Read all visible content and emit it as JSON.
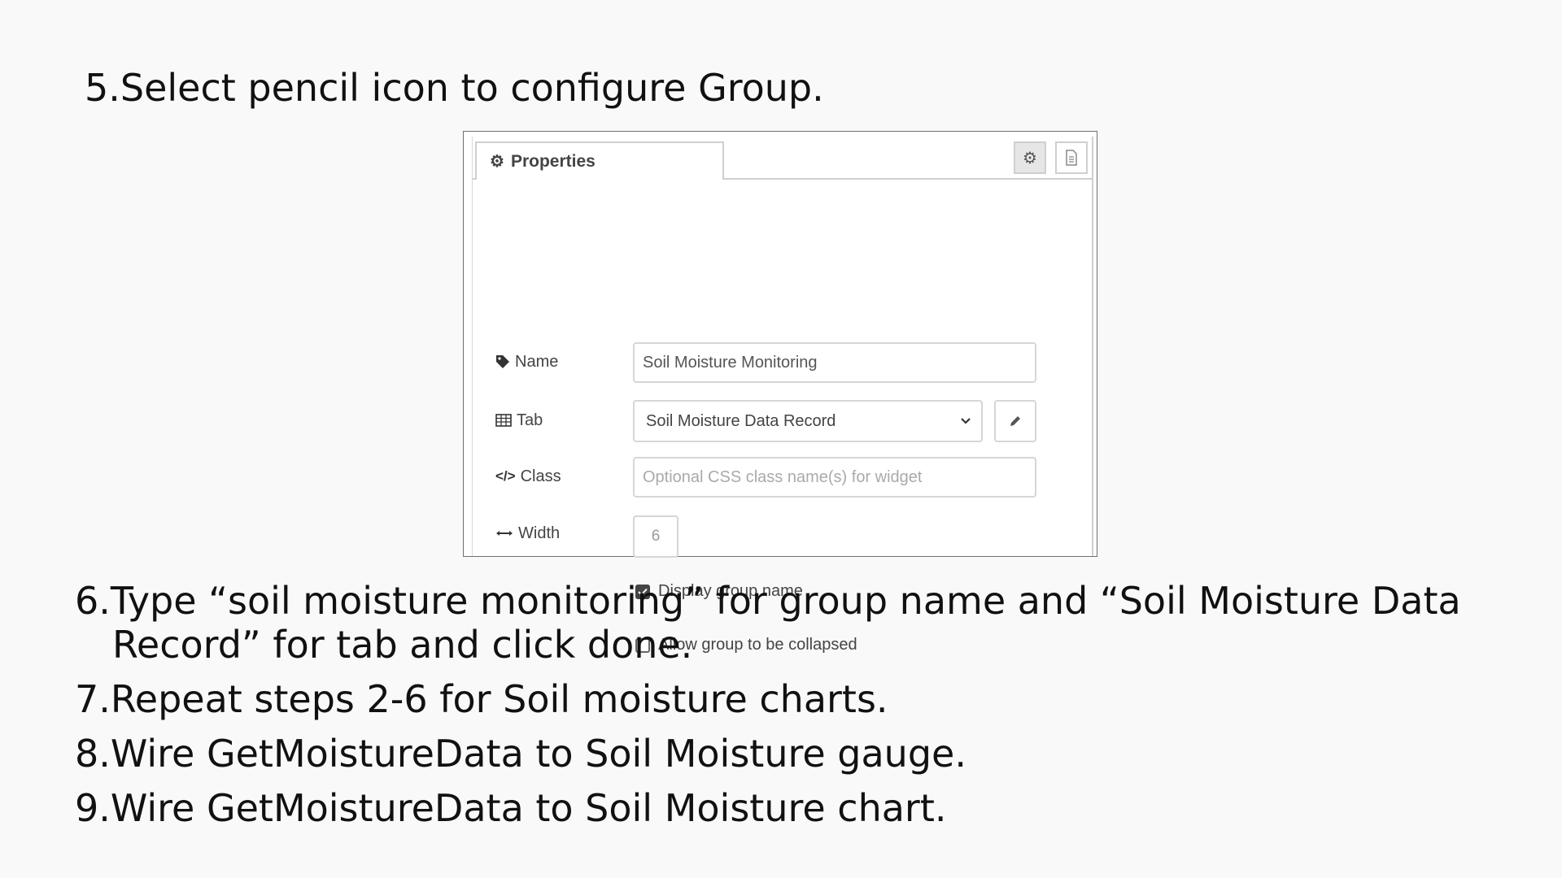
{
  "step5": "5.Select pencil icon to configure Group.",
  "properties_panel": {
    "tab_label": "Properties",
    "name_label": "Name",
    "name_value": "Soil Moisture Monitoring",
    "tab_field_label": "Tab",
    "tab_value": "Soil Moisture Data Record",
    "class_label": "Class",
    "class_placeholder": "Optional CSS class name(s) for widget",
    "width_label": "Width",
    "width_value": "6",
    "display_group_name": {
      "label": "Display group name",
      "checked": true
    },
    "allow_collapse": {
      "label": "Allow group to be collapsed",
      "checked": false
    }
  },
  "steps": [
    {
      "line1": "6.Type “soil moisture monitoring” for group name and “Soil Moisture Data",
      "line2": "Record” for tab and click done."
    },
    {
      "line1": "7.Repeat steps 2-6 for Soil moisture charts."
    },
    {
      "line1": "8.Wire GetMoistureData to Soil Moisture gauge."
    },
    {
      "line1": "9.Wire GetMoistureData to Soil Moisture chart."
    }
  ]
}
